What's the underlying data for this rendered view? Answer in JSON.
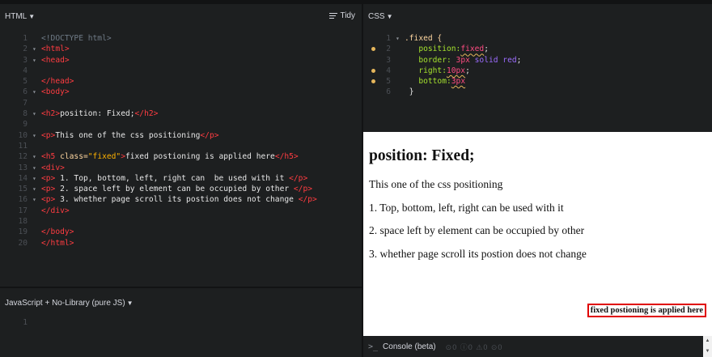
{
  "html_panel": {
    "title": "HTML",
    "tidy_label": "Tidy",
    "lines": [
      {
        "n": "1",
        "fold": false,
        "parts": [
          [
            "c-comment",
            "<!DOCTYPE html>"
          ]
        ]
      },
      {
        "n": "2",
        "fold": true,
        "parts": [
          [
            "c-tag",
            "<html>"
          ]
        ]
      },
      {
        "n": "3",
        "fold": true,
        "parts": [
          [
            "c-tag",
            "<head>"
          ]
        ]
      },
      {
        "n": "4",
        "fold": false,
        "parts": []
      },
      {
        "n": "5",
        "fold": false,
        "parts": [
          [
            "c-tag",
            "</head>"
          ]
        ]
      },
      {
        "n": "6",
        "fold": true,
        "parts": [
          [
            "c-tag",
            "<body>"
          ]
        ]
      },
      {
        "n": "7",
        "fold": false,
        "parts": []
      },
      {
        "n": "8",
        "fold": true,
        "parts": [
          [
            "c-tag",
            "<h2>"
          ],
          [
            "c-text",
            "position: Fixed;"
          ],
          [
            "c-tag",
            "</h2>"
          ]
        ]
      },
      {
        "n": "9",
        "fold": false,
        "parts": []
      },
      {
        "n": "10",
        "fold": true,
        "parts": [
          [
            "c-tag",
            "<p>"
          ],
          [
            "c-text",
            "This one of the css positioning"
          ],
          [
            "c-tag",
            "</p>"
          ]
        ]
      },
      {
        "n": "11",
        "fold": false,
        "parts": []
      },
      {
        "n": "12",
        "fold": true,
        "parts": [
          [
            "c-tag",
            "<h5 "
          ],
          [
            "c-attr",
            "class="
          ],
          [
            "c-str",
            "\"fixed\""
          ],
          [
            "c-tag",
            ">"
          ],
          [
            "c-text",
            "fixed postioning is applied here"
          ],
          [
            "c-tag",
            "</h5>"
          ]
        ]
      },
      {
        "n": "13",
        "fold": true,
        "parts": [
          [
            "c-tag",
            "<div>"
          ]
        ]
      },
      {
        "n": "14",
        "fold": true,
        "parts": [
          [
            "c-tag",
            "<p>"
          ],
          [
            "c-text",
            " 1. Top, bottom, left, right can  be used with it "
          ],
          [
            "c-tag",
            "</p>"
          ]
        ]
      },
      {
        "n": "15",
        "fold": true,
        "parts": [
          [
            "c-tag",
            "<p>"
          ],
          [
            "c-text",
            " 2. space left by element can be occupied by other "
          ],
          [
            "c-tag",
            "</p>"
          ]
        ]
      },
      {
        "n": "16",
        "fold": true,
        "parts": [
          [
            "c-tag",
            "<p>"
          ],
          [
            "c-text",
            " 3. whether page scroll its postion does not change "
          ],
          [
            "c-tag",
            "</p>"
          ]
        ]
      },
      {
        "n": "17",
        "fold": false,
        "parts": [
          [
            "c-tag",
            "</div>"
          ]
        ]
      },
      {
        "n": "18",
        "fold": false,
        "parts": []
      },
      {
        "n": "19",
        "fold": false,
        "parts": [
          [
            "c-tag",
            "</body>"
          ]
        ]
      },
      {
        "n": "20",
        "fold": false,
        "parts": [
          [
            "c-tag",
            "</html>"
          ]
        ]
      }
    ]
  },
  "css_panel": {
    "title": "CSS",
    "lines": [
      {
        "n": "1",
        "fold": true,
        "mark": false,
        "parts": [
          [
            "c-sel",
            ".fixed {"
          ]
        ]
      },
      {
        "n": "2",
        "fold": false,
        "mark": true,
        "parts": [
          [
            "c-prop",
            "   position:"
          ],
          [
            "c-val squiggle",
            "fixed"
          ],
          [
            "c-text",
            ";"
          ]
        ]
      },
      {
        "n": "3",
        "fold": false,
        "mark": false,
        "parts": [
          [
            "c-prop",
            "   border: "
          ],
          [
            "c-val",
            "3px "
          ],
          [
            "c-val2",
            "solid red"
          ],
          [
            "c-text",
            ";"
          ]
        ]
      },
      {
        "n": "4",
        "fold": false,
        "mark": true,
        "parts": [
          [
            "c-prop",
            "   right:"
          ],
          [
            "c-val squiggle",
            "10px"
          ],
          [
            "c-text",
            ";"
          ]
        ]
      },
      {
        "n": "5",
        "fold": false,
        "mark": true,
        "parts": [
          [
            "c-prop",
            "   bottom:"
          ],
          [
            "c-val squiggle",
            "3px"
          ]
        ]
      },
      {
        "n": "6",
        "fold": false,
        "mark": false,
        "parts": [
          [
            "c-text",
            " }"
          ]
        ]
      }
    ]
  },
  "js_panel": {
    "title": "JavaScript + No-Library (pure JS)",
    "lines": [
      {
        "n": "1"
      }
    ]
  },
  "result": {
    "heading": "position: Fixed;",
    "intro": "This one of the css positioning",
    "items": [
      "1. Top, bottom, left, right can be used with it",
      "2. space left by element can be occupied by other",
      "3. whether page scroll its postion does not change"
    ],
    "fixed_text": "fixed postioning is applied here"
  },
  "console": {
    "label": "Console (beta)",
    "counts": [
      "0",
      "0",
      "0",
      "0"
    ]
  }
}
